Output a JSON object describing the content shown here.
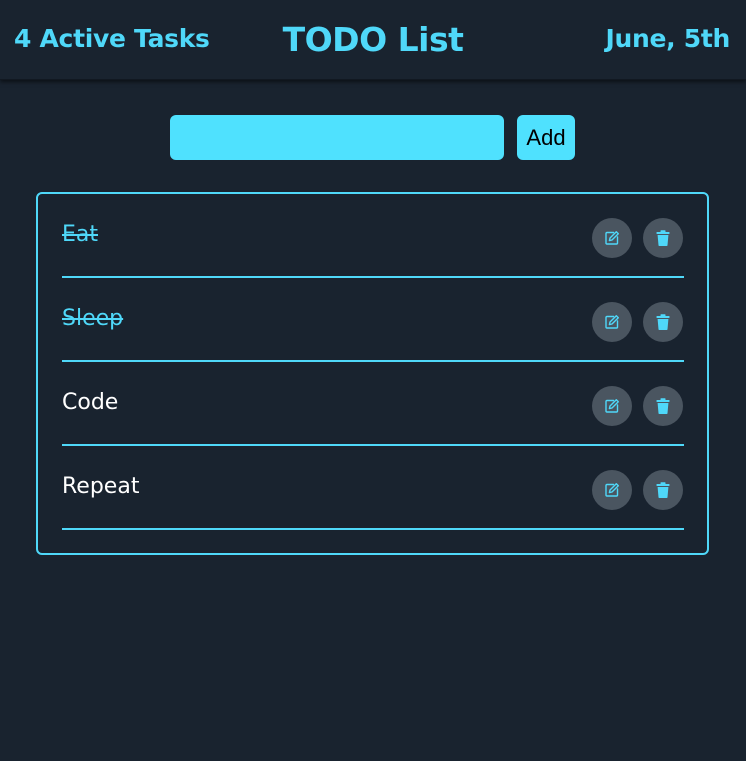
{
  "header": {
    "active_count": "4 Active Tasks",
    "title": "TODO List",
    "date": "June, 5th"
  },
  "form": {
    "input_value": "",
    "add_label": "Add"
  },
  "todos": [
    {
      "label": "Eat",
      "completed": true
    },
    {
      "label": "Sleep",
      "completed": true
    },
    {
      "label": "Code",
      "completed": false
    },
    {
      "label": "Repeat",
      "completed": false
    }
  ],
  "icons": {
    "edit": "edit-icon",
    "delete": "trash-icon"
  },
  "colors": {
    "background": "#19232f",
    "accent": "#4fd8f9",
    "input_fill": "#4fe1fe",
    "icon_button_bg": "#4a5560",
    "text": "#ffffff"
  }
}
